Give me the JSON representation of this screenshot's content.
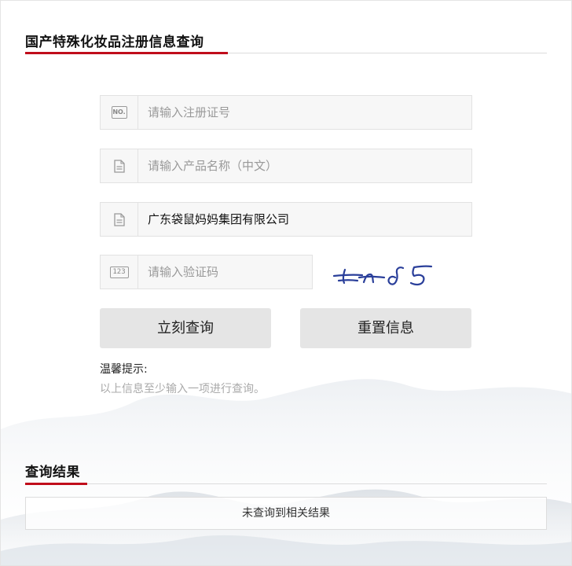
{
  "form": {
    "title": "国产特殊化妆品注册信息查询",
    "reg_no": {
      "placeholder": "请输入注册证号",
      "value": "",
      "icon": "no-badge-icon",
      "icon_text": "NO."
    },
    "product_name": {
      "placeholder": "请输入产品名称（中文）",
      "value": "",
      "icon": "document-icon"
    },
    "company": {
      "placeholder": "",
      "value": "广东袋鼠妈妈集团有限公司",
      "icon": "document-icon"
    },
    "captcha": {
      "placeholder": "请输入验证码",
      "value": "",
      "icon": "number-pad-icon",
      "icon_text": "123",
      "image_text": "Fnd5"
    },
    "query_button": "立刻查询",
    "reset_button": "重置信息",
    "tip_title": "温馨提示:",
    "tip_text": "以上信息至少输入一项进行查询。"
  },
  "results": {
    "title": "查询结果",
    "message": "未查询到相关结果"
  },
  "colors": {
    "accent": "#c00d1b",
    "captcha_ink": "#2a3f9a",
    "button_bg": "#e5e5e5",
    "field_bg": "#f7f7f7"
  }
}
